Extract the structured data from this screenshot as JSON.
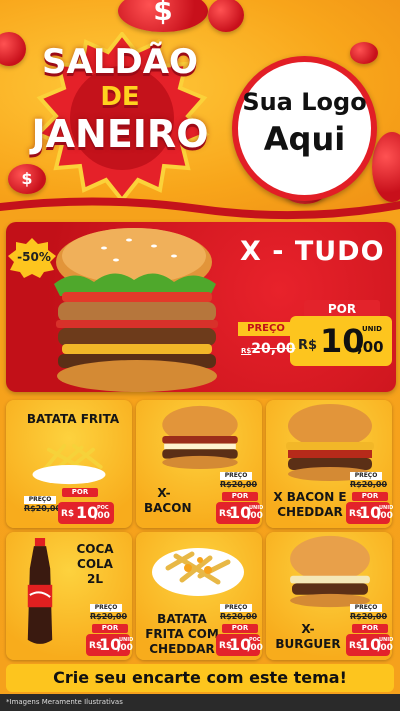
{
  "header": {
    "title_line1": "SALDÃO",
    "title_line2": "DE",
    "title_line3": "JANEIRO",
    "logo_line1": "Sua Logo",
    "logo_line2": "Aqui",
    "coin_symbol": "$"
  },
  "featured": {
    "discount": "-50%",
    "name": "X - TUDO",
    "preco_label": "PREÇO",
    "old_currency": "R$",
    "old_price": "20,00",
    "por_label": "POR",
    "currency": "R$",
    "price_int": "10",
    "price_dec": ",00",
    "unit": "UNID"
  },
  "products": [
    {
      "name": "BATATA FRITA",
      "preco_label": "PREÇO",
      "old_price": "R$20,00",
      "por_label": "POR",
      "currency": "R$",
      "price_int": "10",
      "price_dec": ",00",
      "unit": "POC"
    },
    {
      "name": "X-\nBACON",
      "preco_label": "PREÇO",
      "old_price": "R$20,00",
      "por_label": "POR",
      "currency": "R$",
      "price_int": "10",
      "price_dec": ",00",
      "unit": "UNID"
    },
    {
      "name": "X BACON E\nCHEDDAR",
      "preco_label": "PREÇO",
      "old_price": "R$20,00",
      "por_label": "POR",
      "currency": "R$",
      "price_int": "10",
      "price_dec": ",00",
      "unit": "UNID"
    },
    {
      "name": "COCA\nCOLA\n2L",
      "preco_label": "PREÇO",
      "old_price": "R$20,00",
      "por_label": "POR",
      "currency": "R$",
      "price_int": "10",
      "price_dec": ",00",
      "unit": "UNID"
    },
    {
      "name": "BATATA\nFRITA COM\nCHEDDAR",
      "preco_label": "PREÇO",
      "old_price": "R$20,00",
      "por_label": "POR",
      "currency": "R$",
      "price_int": "10",
      "price_dec": ",00",
      "unit": "POC"
    },
    {
      "name": "X-\nBURGUER",
      "preco_label": "PREÇO",
      "old_price": "R$20,00",
      "por_label": "POR",
      "currency": "R$",
      "price_int": "10",
      "price_dec": ",00",
      "unit": "UNID"
    }
  ],
  "cta": "Crie seu encarte com este tema!",
  "footer_note": "*Imagens Meramente Ilustrativas",
  "colors": {
    "red": "#e3232b",
    "yellow": "#fdc51e",
    "orange": "#f6a21b"
  }
}
